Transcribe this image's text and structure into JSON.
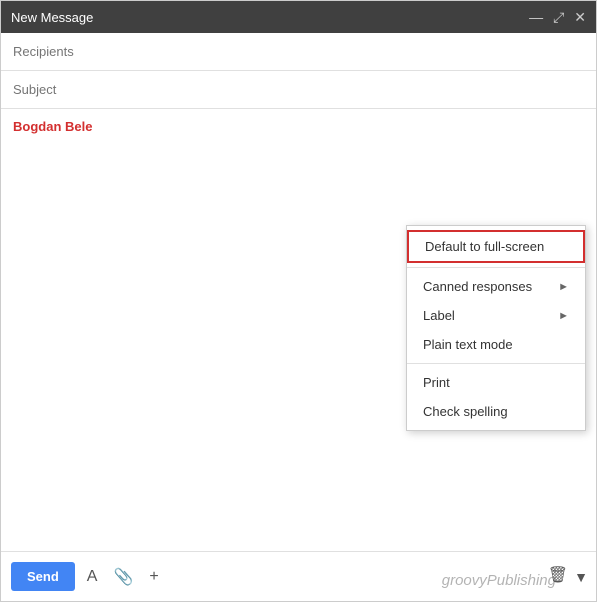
{
  "window": {
    "title": "New Message"
  },
  "title_bar_controls": {
    "minimize": "—",
    "expand": "⤢",
    "close": "✕"
  },
  "compose": {
    "recipients_placeholder": "Recipients",
    "subject_placeholder": "Subject",
    "body_text": "Bogdan Bele"
  },
  "context_menu": {
    "items": [
      {
        "label": "Default to full-screen",
        "highlighted": true,
        "has_arrow": false
      },
      {
        "label": "",
        "separator": true
      },
      {
        "label": "Canned responses",
        "highlighted": false,
        "has_arrow": true
      },
      {
        "label": "Label",
        "highlighted": false,
        "has_arrow": true
      },
      {
        "label": "Plain text mode",
        "highlighted": false,
        "has_arrow": false
      },
      {
        "label": "",
        "separator": true
      },
      {
        "label": "Print",
        "highlighted": false,
        "has_arrow": false
      },
      {
        "label": "Check spelling",
        "highlighted": false,
        "has_arrow": false
      }
    ]
  },
  "toolbar": {
    "send_label": "Send"
  },
  "watermark": {
    "text": "groovyPublishing"
  }
}
